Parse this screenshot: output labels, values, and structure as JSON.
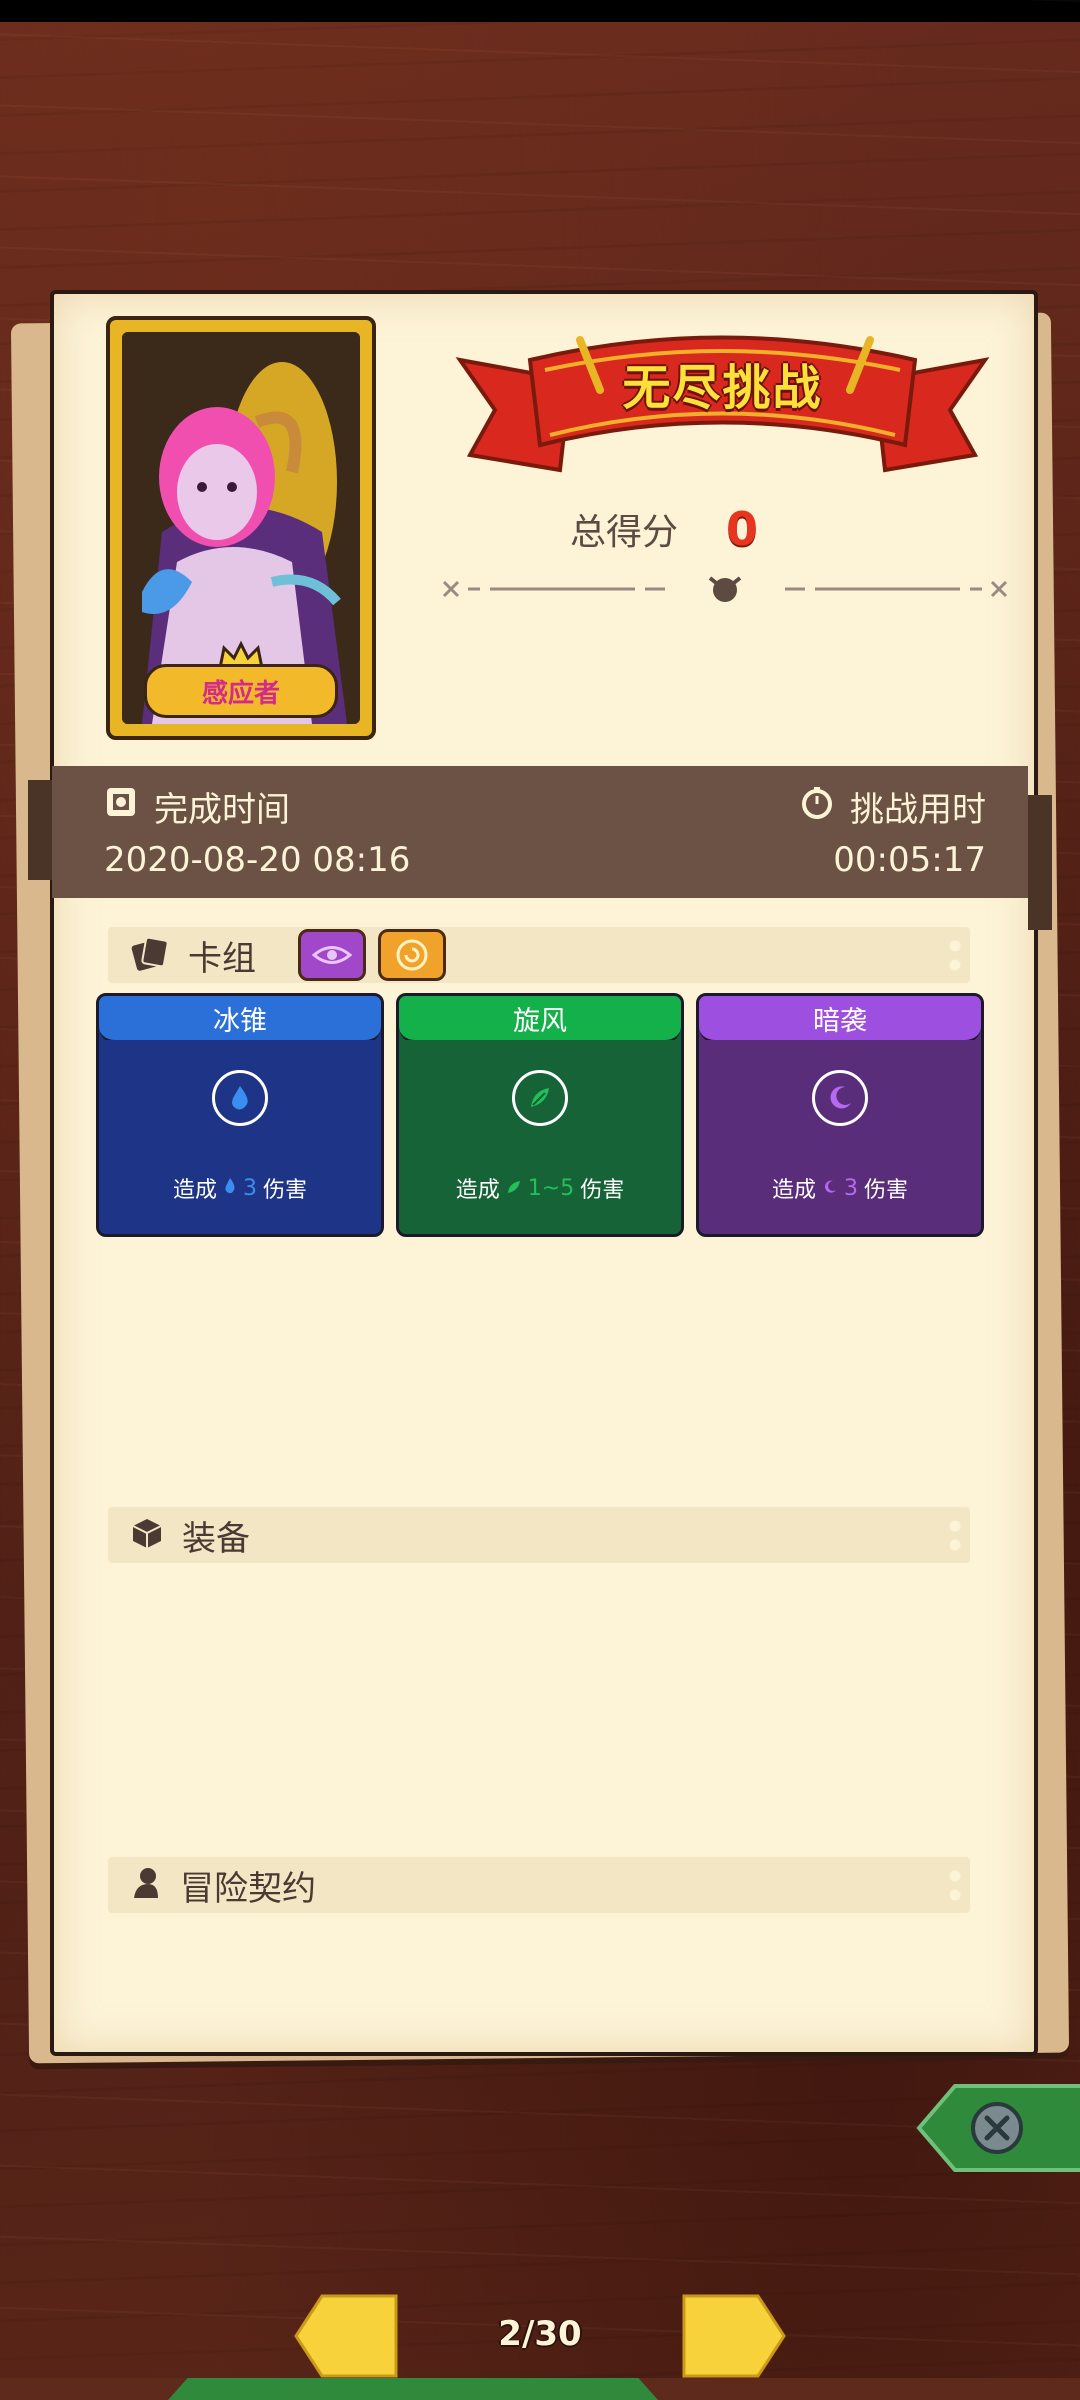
{
  "character": {
    "name": "感应者"
  },
  "banner": {
    "title": "无尽挑战"
  },
  "score": {
    "label": "总得分",
    "value": "0"
  },
  "info": {
    "finish_time_label": "完成时间",
    "finish_time_value": "2020-08-20 08:16",
    "duration_label": "挑战用时",
    "duration_value": "00:05:17"
  },
  "sections": {
    "deck": "卡组",
    "equipment": "装备",
    "contract": "冒险契约"
  },
  "cards": [
    {
      "name": "冰锥",
      "text_prefix": "造成",
      "amount": "3",
      "text_suffix": "伤害",
      "element": "water",
      "header_color": "#2b6fd8",
      "body_color": "#1d3487",
      "accent": "#3a8ef0"
    },
    {
      "name": "旋风",
      "text_prefix": "造成",
      "amount": "1~5",
      "text_suffix": "伤害",
      "element": "wind",
      "header_color": "#14b04a",
      "body_color": "#156336",
      "accent": "#22c05a"
    },
    {
      "name": "暗袭",
      "text_prefix": "造成",
      "amount": "3",
      "text_suffix": "伤害",
      "element": "shadow",
      "header_color": "#9d4fe0",
      "body_color": "#5a2d7a",
      "accent": "#b66af0"
    }
  ],
  "pagination": {
    "current": "2/30"
  },
  "colors": {
    "paper": "#fdf3d7",
    "band": "#6b5244",
    "score_red": "#e8351f",
    "banner_red": "#d9281e",
    "close_green": "#2f8a3c"
  },
  "icons": {
    "deck": "cards-icon",
    "equipment": "box-icon",
    "contract": "person-icon",
    "finish_time": "calendar-icon",
    "duration": "stopwatch-icon",
    "close": "close-icon"
  }
}
